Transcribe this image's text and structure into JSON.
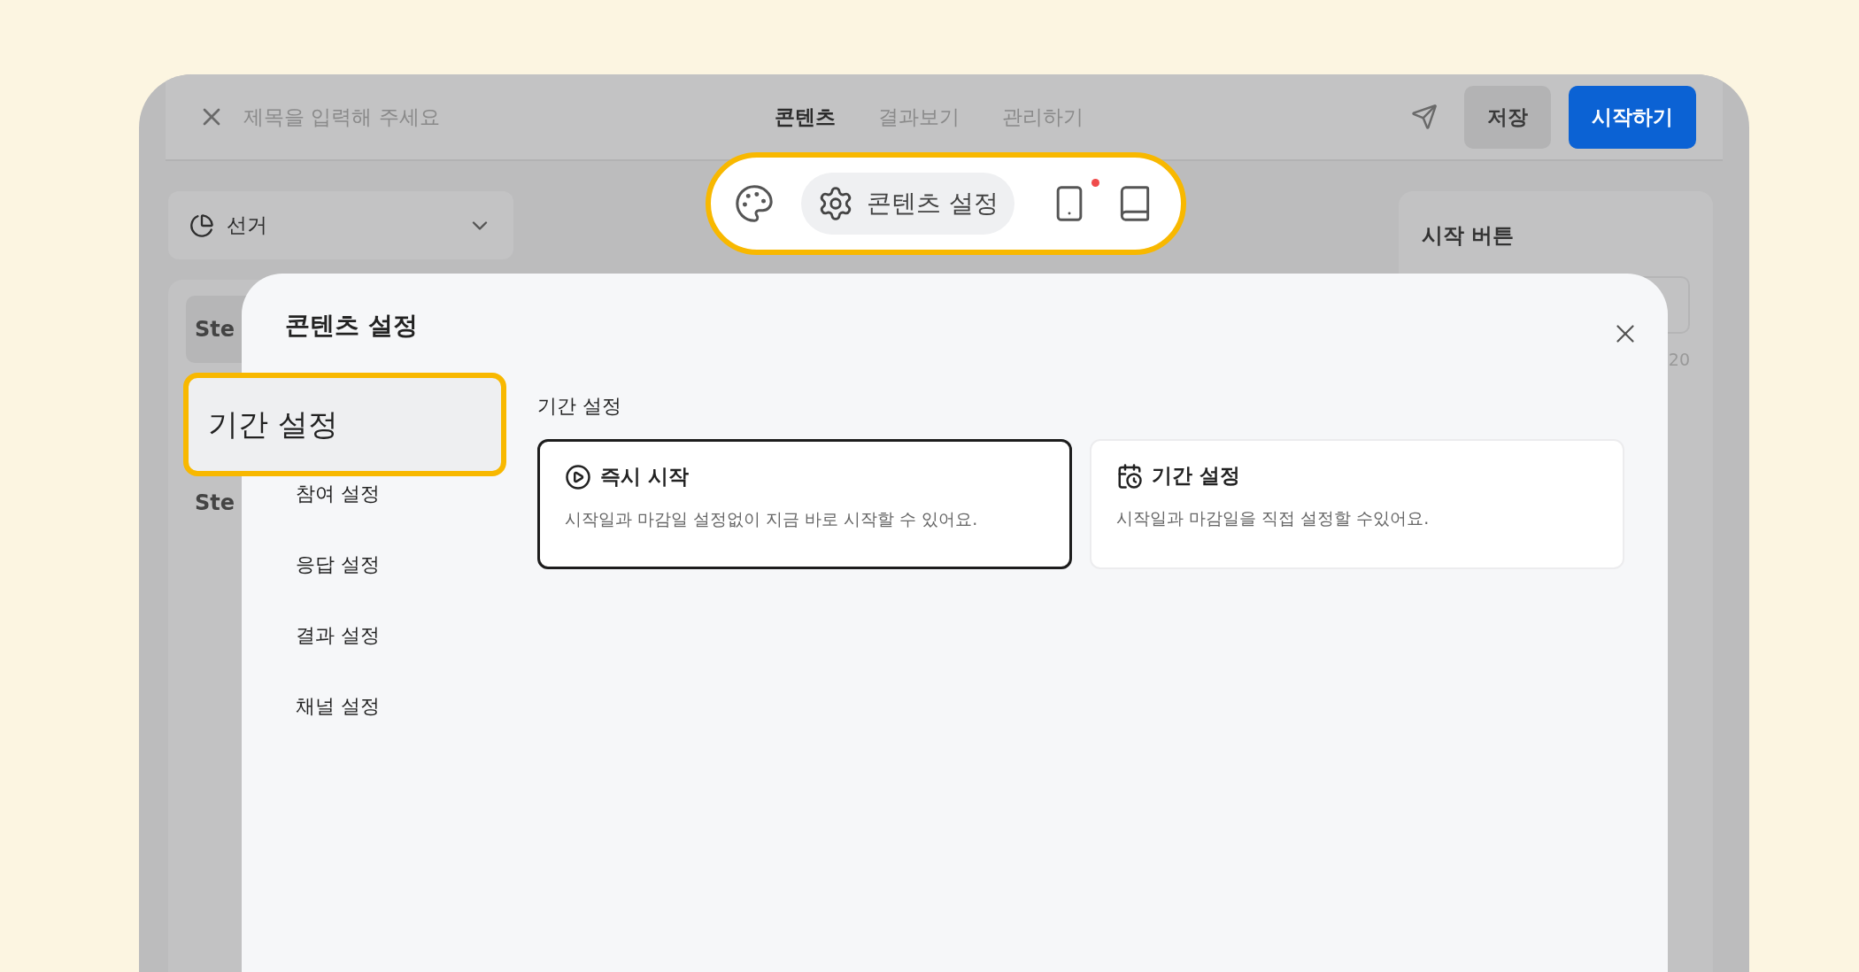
{
  "topbar": {
    "title_placeholder": "제목을 입력해 주세요",
    "tabs": [
      {
        "label": "콘텐츠",
        "selected": true
      },
      {
        "label": "결과보기",
        "selected": false
      },
      {
        "label": "관리하기",
        "selected": false
      }
    ],
    "save_button": "저장",
    "start_button": "시작하기"
  },
  "left_panel": {
    "dropdown": "선거",
    "steps": [
      {
        "label": "Ste",
        "selected": true
      },
      {
        "label": "Ste",
        "selected": false
      }
    ]
  },
  "right_panel": {
    "title": "시작 버튼",
    "counter": "20"
  },
  "toolbar": {
    "settings_label": "콘텐츠 설정",
    "notification_dot": true
  },
  "modal": {
    "title": "콘텐츠 설정",
    "nav": [
      {
        "label": "기간 설정",
        "selected": true
      },
      {
        "label": "참여 설정",
        "selected": false
      },
      {
        "label": "응답 설정",
        "selected": false
      },
      {
        "label": "결과 설정",
        "selected": false
      },
      {
        "label": "채널 설정",
        "selected": false
      }
    ],
    "section_title": "기간 설정",
    "options": [
      {
        "kind": "play",
        "title": "즉시 시작",
        "description": "시작일과 마감일 설정없이 지금 바로 시작할 수 있어요.",
        "selected": true
      },
      {
        "kind": "calendar",
        "title": "기간 설정",
        "description": "시작일과 마감일을 직접 설정할 수있어요.",
        "selected": false
      }
    ]
  }
}
